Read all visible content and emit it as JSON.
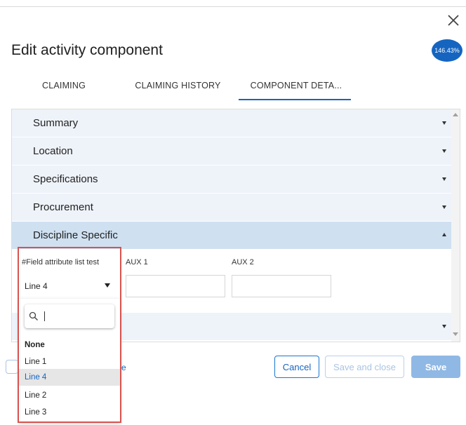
{
  "dialog": {
    "title": "Edit activity component",
    "zoom_badge": "146.43%"
  },
  "tabs": [
    {
      "label": "CLAIMING",
      "active": false
    },
    {
      "label": "CLAIMING HISTORY",
      "active": false
    },
    {
      "label": "COMPONENT DETA...",
      "active": true
    }
  ],
  "sections": [
    {
      "label": "Summary",
      "expanded": false
    },
    {
      "label": "Location",
      "expanded": false
    },
    {
      "label": "Specifications",
      "expanded": false
    },
    {
      "label": "Procurement",
      "expanded": false
    },
    {
      "label": "Discipline Specific",
      "expanded": true
    },
    {
      "label": "",
      "expanded": false
    }
  ],
  "fields": {
    "field_attribute": {
      "label": "#Field attribute list test",
      "value": "Line 4"
    },
    "aux1": {
      "label": "AUX 1",
      "value": ""
    },
    "aux2": {
      "label": "AUX 2",
      "value": ""
    }
  },
  "dropdown": {
    "search_value": "",
    "options": [
      "None",
      "Line 1",
      "Line 4",
      "Line 2",
      "Line 3"
    ],
    "selected": "Line 4"
  },
  "footer": {
    "partial_link": "e",
    "cancel_label": "Cancel",
    "save_close_label": "Save and close",
    "save_label": "Save"
  },
  "colors": {
    "accent": "#1565c0",
    "section_bg": "#eef3fa",
    "section_active_bg": "#cfe0f1",
    "highlight_frame": "#d9534f"
  },
  "icons": [
    "close-icon",
    "search-icon",
    "chevron-down-icon",
    "chevron-up-icon"
  ]
}
